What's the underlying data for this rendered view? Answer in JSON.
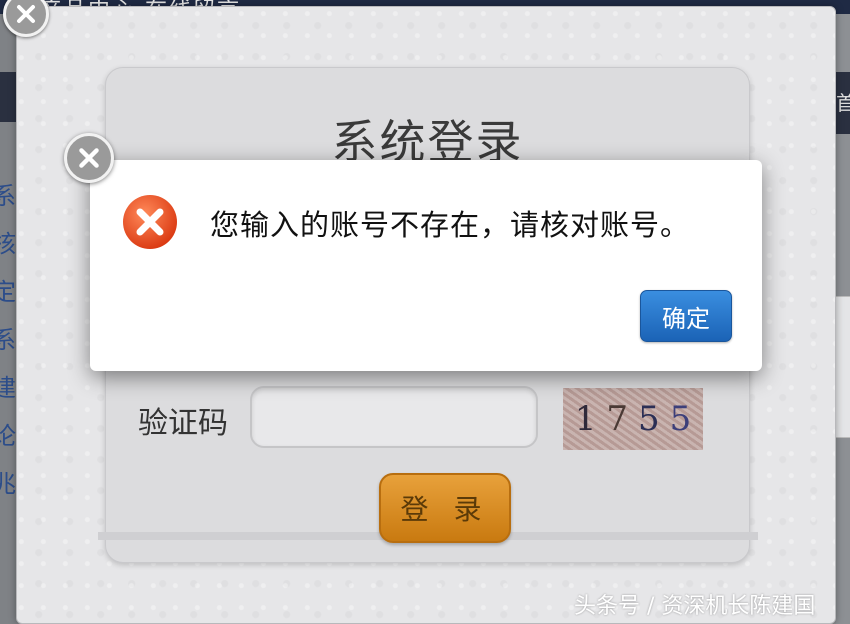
{
  "background": {
    "topbar_text": "产品中心  在线留言",
    "left_chars": [
      "系",
      "核",
      "定",
      "系",
      "建",
      "论",
      "兆"
    ],
    "right_nav_char": "首"
  },
  "login_panel": {
    "title": "系统登录",
    "captcha_label": "验证码",
    "captcha_input_value": "",
    "captcha_digits": [
      "1",
      "7",
      "5",
      "5"
    ],
    "login_button_label": "登 录"
  },
  "alert": {
    "message": "您输入的账号不存在，请核对账号。",
    "ok_button_label": "确定"
  },
  "watermark": "头条号 / 资深机长陈建国",
  "colors": {
    "ok_button": "#1b63b6",
    "login_button": "#d88a1f",
    "error_icon": "#e8491d"
  }
}
